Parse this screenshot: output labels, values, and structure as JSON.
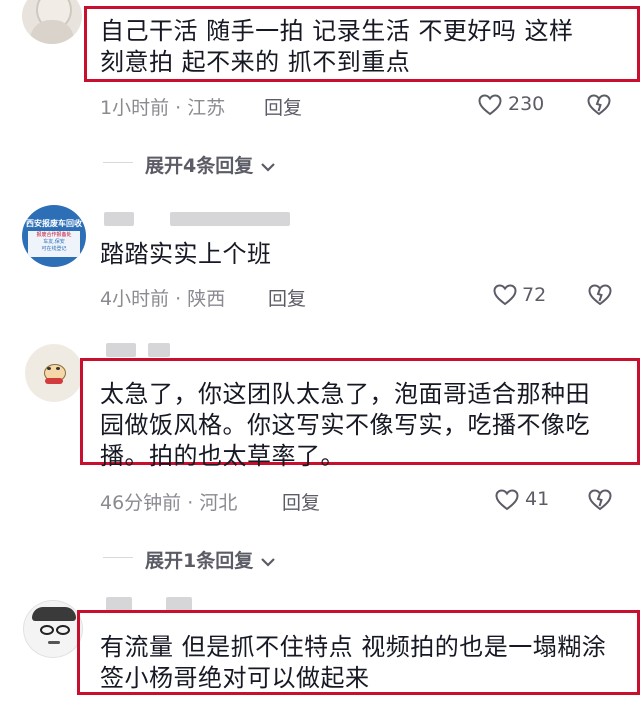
{
  "comments": [
    {
      "text_lines": [
        "自己干活  随手一拍  记录生活  不更好吗  这样",
        "刻意拍  起不来的   抓不到重点"
      ],
      "time": "1小时前",
      "location": "江苏",
      "reply_label": "回复",
      "likes": "230"
    },
    {
      "text_lines": [
        "踏踏实实上个班"
      ],
      "time": "4小时前",
      "location": "陕西",
      "reply_label": "回复",
      "likes": "72",
      "avatar_text": [
        "西安报废车回收",
        "报废合作报备处",
        "车友,保安",
        "可在线登记",
        "手续齐全",
        "价格公道"
      ]
    },
    {
      "text_lines": [
        "太急了，你这团队太急了，泡面哥适合那种田",
        "园做饭风格。你这写实不像写实，吃播不像吃",
        "播。拍的也太草率了。"
      ],
      "time": "46分钟前",
      "location": "河北",
      "reply_label": "回复",
      "likes": "41"
    },
    {
      "text_lines": [
        "有流量 但是抓不住特点 视频拍的也是一塌糊涂",
        "签小杨哥绝对可以做起来"
      ]
    }
  ],
  "expand_1": "展开4条回复",
  "expand_2": "展开1条回复",
  "dot": "·",
  "colors": {
    "highlight_box": "#c8102e",
    "text": "#161823",
    "meta": "#8a8b91"
  },
  "icons": [
    "heart-outline-icon",
    "dislike-heart-icon",
    "chevron-down-icon"
  ]
}
